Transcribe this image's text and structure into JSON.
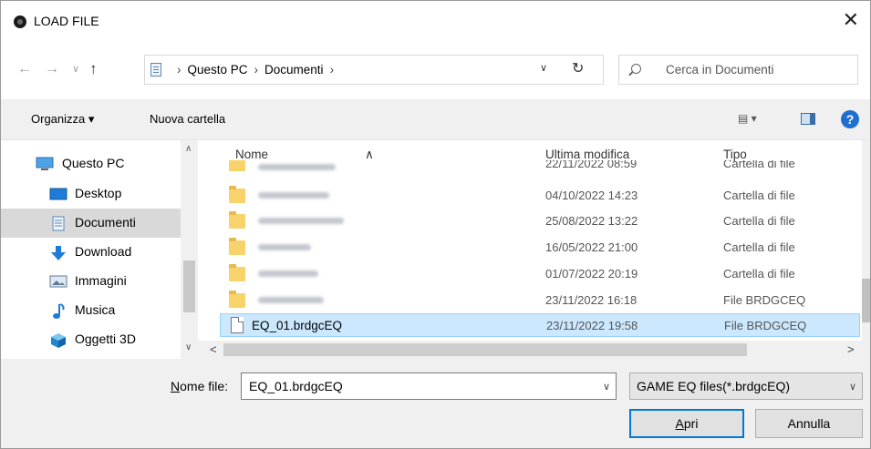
{
  "window": {
    "title": "LOAD FILE",
    "close": "✕"
  },
  "nav": {
    "back": "←",
    "forward": "→",
    "recent": "∨",
    "up": "↑",
    "breadcrumb": [
      "Questo PC",
      "Documenti"
    ],
    "separator": "›",
    "dropdown": "∨",
    "refresh": "↻",
    "search_placeholder": "Cerca in Documenti"
  },
  "toolbar": {
    "organize": "Organizza ▾",
    "new_folder": "Nuova cartella",
    "view": "▤ ▾",
    "help": "?"
  },
  "sidebar": {
    "items": [
      {
        "label": "Questo PC",
        "icon": "computer-icon"
      },
      {
        "label": "Desktop",
        "icon": "desktop-icon"
      },
      {
        "label": "Documenti",
        "icon": "documents-icon",
        "selected": true
      },
      {
        "label": "Download",
        "icon": "download-icon"
      },
      {
        "label": "Immagini",
        "icon": "pictures-icon"
      },
      {
        "label": "Musica",
        "icon": "music-icon"
      },
      {
        "label": "Oggetti 3D",
        "icon": "3d-objects-icon"
      }
    ],
    "scroll_up": "∧",
    "scroll_down": "∨"
  },
  "files": {
    "columns": {
      "name": "Nome",
      "modified": "Ultima modifica",
      "type": "Tipo"
    },
    "sort_indicator": "∧",
    "rows": [
      {
        "name": "",
        "blurred": true,
        "icon": "folder-icon",
        "modified": "22/11/2022 08:59",
        "type": "Cartella di file"
      },
      {
        "name": "",
        "blurred": true,
        "icon": "folder-icon",
        "modified": "04/10/2022 14:23",
        "type": "Cartella di file"
      },
      {
        "name": "",
        "blurred": true,
        "icon": "folder-icon",
        "modified": "25/08/2022 13:22",
        "type": "Cartella di file"
      },
      {
        "name": "",
        "blurred": true,
        "icon": "folder-icon",
        "modified": "16/05/2022 21:00",
        "type": "Cartella di file"
      },
      {
        "name": "",
        "blurred": true,
        "icon": "folder-icon",
        "modified": "01/07/2022 20:19",
        "type": "Cartella di file"
      },
      {
        "name": "",
        "blurred": true,
        "icon": "folder-icon",
        "modified": "23/11/2022 16:18",
        "type": "File BRDGCEQ"
      },
      {
        "name": "EQ_01.brdgcEQ",
        "blurred": false,
        "icon": "file-icon",
        "modified": "23/11/2022 19:58",
        "type": "File BRDGCEQ",
        "selected": true
      }
    ],
    "scroll_left": "<",
    "scroll_right": ">"
  },
  "footer": {
    "filename_label_u": "N",
    "filename_label_rest": "ome file:",
    "filename_value": "EQ_01.brdgcEQ",
    "filter_value": "GAME EQ files(*.brdgcEQ)",
    "dropdown": "∨",
    "open_u": "A",
    "open_rest": "pri",
    "cancel": "Annulla"
  },
  "colors": {
    "selection": "#cce8ff",
    "accent": "#0078d7",
    "folder": "#f8d36b"
  }
}
